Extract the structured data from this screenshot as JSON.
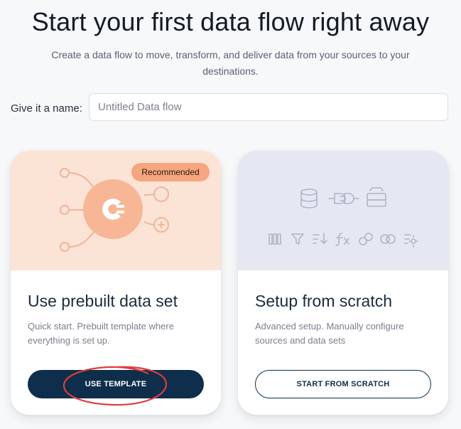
{
  "header": {
    "title": "Start your first data flow right away",
    "subtitle": "Create a data flow to move, transform, and deliver data from your sources to your destinations."
  },
  "name_field": {
    "label": "Give it a name:",
    "placeholder": "Untitled Data flow",
    "value": ""
  },
  "cards": [
    {
      "title": "Use prebuilt data set",
      "description": "Quick start. Prebuilt template where everything is set up.",
      "badge": "Recommended",
      "button_label": "USE TEMPLATE",
      "hero_color": "#fbe3d6",
      "icons": [
        "input-node-icon",
        "flow-logo-icon",
        "output-node-icon",
        "add-output-icon"
      ]
    },
    {
      "title": "Setup from scratch",
      "description": "Advanced setup. Manually configure sources and data sets",
      "button_label": "START FROM SCRATCH",
      "hero_color": "#e5e8f2",
      "icons": [
        "database-icon",
        "connector-icon",
        "storage-icon",
        "columns-icon",
        "filter-icon",
        "sort-icon",
        "function-icon",
        "link-icon",
        "join-icon",
        "transform-icon"
      ]
    }
  ],
  "colors": {
    "primary": "#0e2e4b",
    "badge": "#f5a67f",
    "annotation": "#e03c3c"
  }
}
